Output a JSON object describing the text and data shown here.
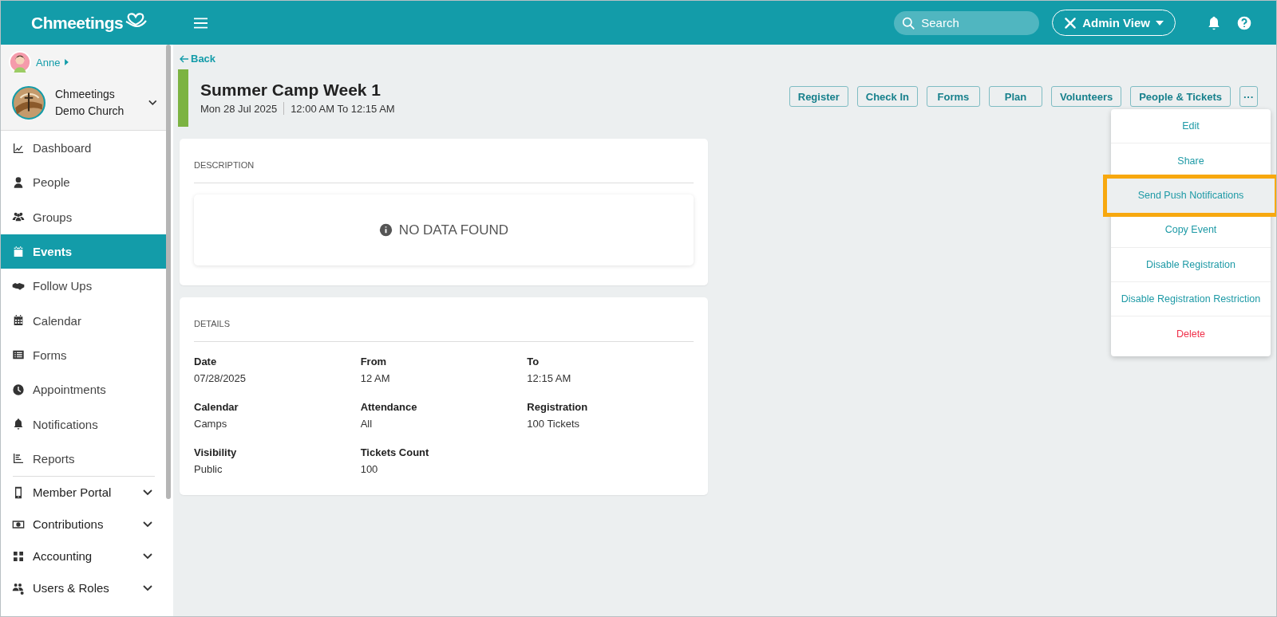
{
  "topbar": {
    "logo": "Chmeetings",
    "search": {
      "placeholder": "Search"
    },
    "view_button": "Admin View"
  },
  "sidebar": {
    "user": "Anne",
    "church": "Chmeetings Demo Church",
    "items": [
      {
        "label": "Dashboard",
        "kind": "link",
        "selected": false
      },
      {
        "label": "People",
        "kind": "link",
        "selected": false
      },
      {
        "label": "Groups",
        "kind": "link",
        "selected": false
      },
      {
        "label": "Events",
        "kind": "link",
        "selected": true
      },
      {
        "label": "Follow Ups",
        "kind": "link",
        "selected": false
      },
      {
        "label": "Calendar",
        "kind": "link",
        "selected": false
      },
      {
        "label": "Forms",
        "kind": "link",
        "selected": false
      },
      {
        "label": "Appointments",
        "kind": "link",
        "selected": false
      },
      {
        "label": "Notifications",
        "kind": "link",
        "selected": false
      },
      {
        "label": "Reports",
        "kind": "link",
        "selected": false
      },
      {
        "label": "Member Portal",
        "kind": "group",
        "expanded": false
      },
      {
        "label": "Contributions",
        "kind": "group",
        "expanded": false
      },
      {
        "label": "Accounting",
        "kind": "group",
        "expanded": false
      },
      {
        "label": "Users & Roles",
        "kind": "group",
        "expanded": false
      }
    ]
  },
  "back": "Back",
  "event": {
    "title": "Summer Camp Week 1",
    "date": "Mon 28 Jul  2025",
    "time": "12:00 AM To 12:15 AM",
    "color": "#7cb342"
  },
  "actions": [
    "Register",
    "Check In",
    "Forms",
    "Plan",
    "Volunteers",
    "People & Tickets",
    "···"
  ],
  "menu": [
    {
      "label": "Edit",
      "kind": "normal",
      "highlighted": false
    },
    {
      "label": "Share",
      "kind": "normal",
      "highlighted": false
    },
    {
      "label": "Send Push Notifications",
      "kind": "normal",
      "highlighted": true
    },
    {
      "label": "Copy Event",
      "kind": "normal",
      "highlighted": false
    },
    {
      "label": "Disable Registration",
      "kind": "normal",
      "highlighted": false
    },
    {
      "label": "Disable Registration Restriction",
      "kind": "normal",
      "highlighted": false
    },
    {
      "label": "Delete",
      "kind": "danger",
      "highlighted": false
    }
  ],
  "description": {
    "heading": "DESCRIPTION",
    "empty": "NO DATA FOUND"
  },
  "details": {
    "heading": "DETAILS",
    "fields": [
      {
        "label": "Date",
        "value": "07/28/2025"
      },
      {
        "label": "From",
        "value": "12 AM"
      },
      {
        "label": "To",
        "value": "12:15 AM"
      },
      {
        "label": "Calendar",
        "value": "Camps"
      },
      {
        "label": "Attendance",
        "value": "All"
      },
      {
        "label": "Registration",
        "value": "100 Tickets"
      },
      {
        "label": "Visibility",
        "value": "Public"
      },
      {
        "label": "Tickets Count",
        "value": "100"
      }
    ]
  }
}
